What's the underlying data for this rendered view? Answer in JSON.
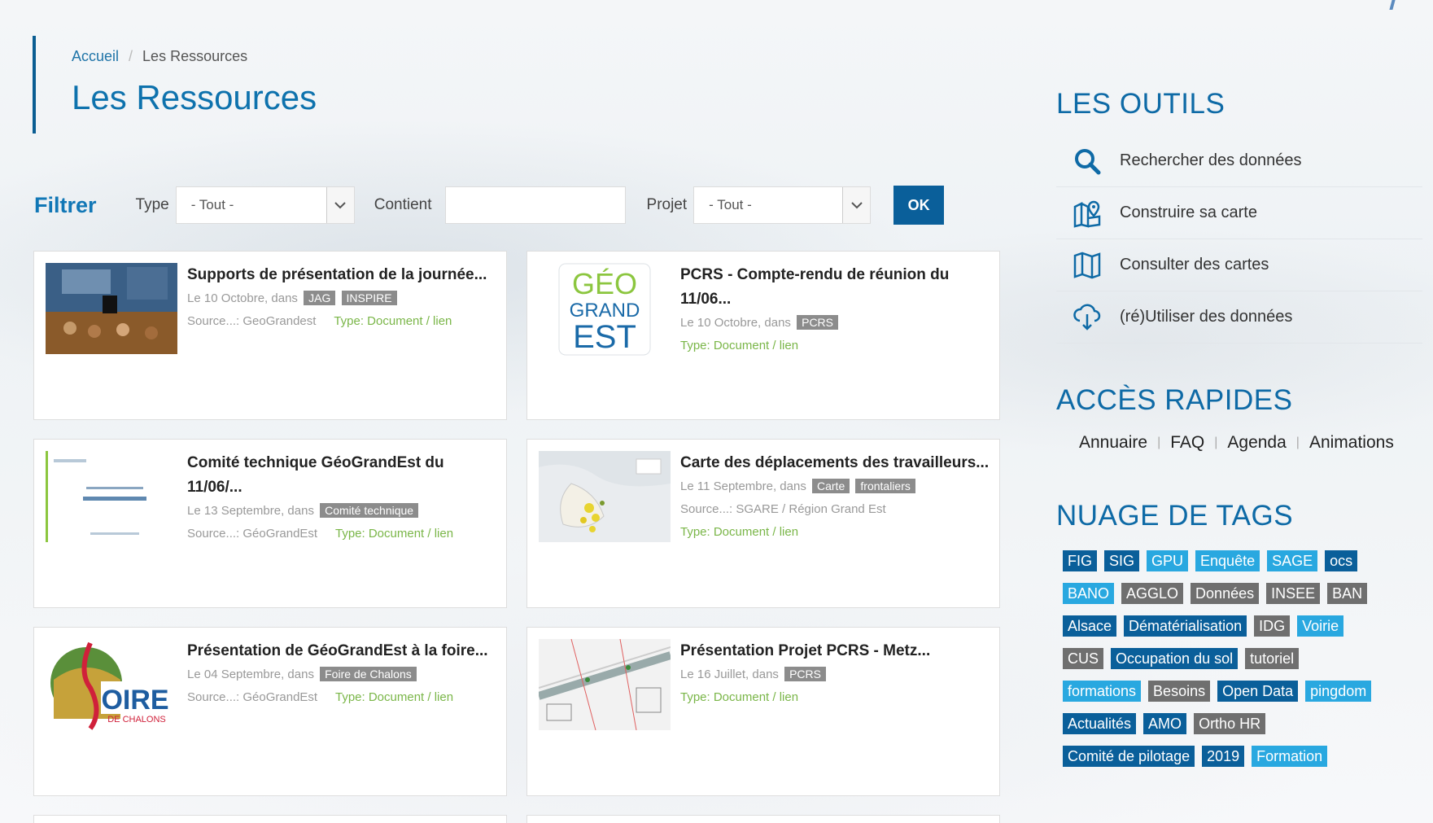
{
  "breadcrumb": {
    "home": "Accueil",
    "separator": "/",
    "current": "Les Ressources"
  },
  "page_title": "Les Ressources",
  "filter": {
    "title": "Filtrer",
    "type_label": "Type",
    "type_value": "- Tout -",
    "contains_label": "Contient",
    "contains_value": "",
    "project_label": "Projet",
    "project_value": "- Tout -",
    "ok_label": "OK"
  },
  "cards": [
    {
      "title": "Supports de présentation de la journée...",
      "date": "Le 10 Octobre, dans",
      "tags": [
        "JAG",
        "INSPIRE"
      ],
      "source": "Source...: GeoGrandest",
      "type": "Type: Document / lien"
    },
    {
      "title": "PCRS - Compte-rendu de réunion du 11/06...",
      "date": "Le 10 Octobre, dans",
      "tags": [
        "PCRS"
      ],
      "source": "",
      "type": "Type: Document / lien",
      "logo_text": [
        "GÉO",
        "GRAND",
        "EST"
      ]
    },
    {
      "title": "Comité technique GéoGrandEst du 11/06/...",
      "date": "Le 13 Septembre, dans",
      "tags": [
        "Comité technique"
      ],
      "source": "Source...: GéoGrandEst",
      "type": "Type: Document / lien"
    },
    {
      "title": "Carte des déplacements des travailleurs...",
      "date": "Le 11 Septembre, dans",
      "tags": [
        "Carte",
        "frontaliers"
      ],
      "source": "Source...: SGARE / Région Grand Est",
      "type": "Type: Document / lien"
    },
    {
      "title": "Présentation de GéoGrandEst à la foire...",
      "date": "Le 04 Septembre, dans",
      "tags": [
        "Foire de Chalons"
      ],
      "source": "Source...: GéoGrandEst",
      "type": "Type: Document / lien",
      "logo_text": [
        "OIRE",
        "DE CHALONS"
      ]
    },
    {
      "title": "Présentation Projet PCRS - Metz...",
      "date": "Le 16 Juillet, dans",
      "tags": [
        "PCRS"
      ],
      "source": "",
      "type": "Type: Document / lien"
    }
  ],
  "tools": {
    "title": "LES OUTILS",
    "items": [
      {
        "label": "Rechercher des données",
        "icon": "search-icon"
      },
      {
        "label": "Construire sa carte",
        "icon": "map-pin-icon"
      },
      {
        "label": "Consulter des cartes",
        "icon": "map-icon"
      },
      {
        "label": "(ré)Utiliser des données",
        "icon": "cloud-download-icon"
      }
    ]
  },
  "quick_access": {
    "title": "ACCÈS RAPIDES",
    "links": [
      "Annuaire",
      "FAQ",
      "Agenda",
      "Animations"
    ],
    "separator": "|"
  },
  "tag_cloud": {
    "title": "NUAGE DE TAGS",
    "rows": [
      [
        [
          "FIG",
          "dark"
        ],
        [
          "SIG",
          "dark"
        ],
        [
          "GPU",
          "light"
        ],
        [
          "Enquête",
          "light"
        ],
        [
          "SAGE",
          "light"
        ],
        [
          "ocs",
          "dark"
        ]
      ],
      [
        [
          "BANO",
          "light"
        ],
        [
          "AGGLO",
          "gray"
        ],
        [
          "Données",
          "gray"
        ],
        [
          "INSEE",
          "gray"
        ],
        [
          "BAN",
          "gray"
        ]
      ],
      [
        [
          "Alsace",
          "dark"
        ],
        [
          "Dématérialisation",
          "dark"
        ],
        [
          "IDG",
          "gray"
        ],
        [
          "Voirie",
          "light"
        ]
      ],
      [
        [
          "CUS",
          "gray"
        ],
        [
          "Occupation du sol",
          "dark"
        ],
        [
          "tutoriel",
          "gray"
        ]
      ],
      [
        [
          "formations",
          "light"
        ],
        [
          "Besoins",
          "gray"
        ],
        [
          "Open Data",
          "dark"
        ],
        [
          "pingdom",
          "light"
        ]
      ],
      [
        [
          "Actualités",
          "dark"
        ],
        [
          "AMO",
          "dark"
        ],
        [
          "Ortho HR",
          "gray"
        ]
      ],
      [
        [
          "Comité de pilotage",
          "dark"
        ],
        [
          "2019",
          "dark"
        ],
        [
          "Formation",
          "light"
        ]
      ]
    ]
  },
  "colors": {
    "primary": "#0a5f9a",
    "title": "#0e72ad",
    "tag_dark": "#0a5f9a",
    "tag_light": "#29a8e0",
    "tag_gray": "#6f6f6f",
    "type_green": "#7ab648"
  }
}
